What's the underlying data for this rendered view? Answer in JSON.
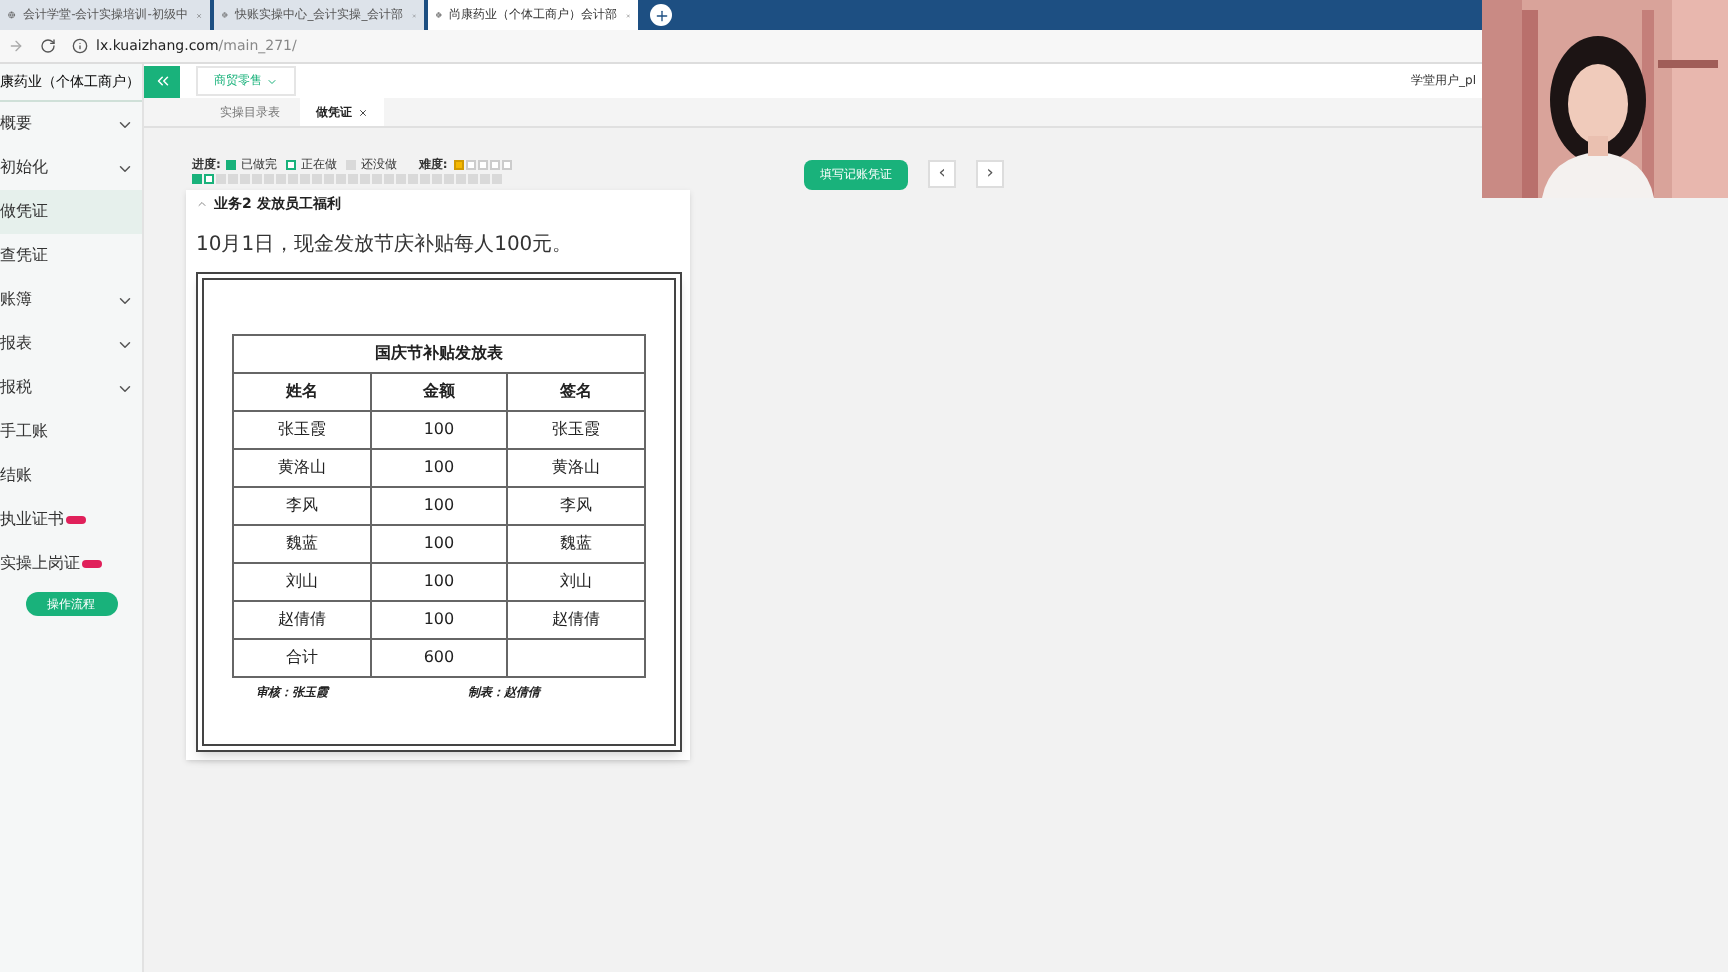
{
  "browser": {
    "tabs": [
      {
        "title": "会计学堂-会计实操培训-初级中",
        "selected": false
      },
      {
        "title": "快账实操中心_会计实操_会计部",
        "selected": false
      },
      {
        "title": "尚康药业（个体工商户）会计部",
        "selected": true
      }
    ],
    "address": {
      "host": "lx.kuaizhang.com",
      "path": "/main_271/"
    }
  },
  "sidebar": {
    "company": "康药业（个体工商户）",
    "items": [
      {
        "label": "概要",
        "expandable": true,
        "selected": false,
        "new": false
      },
      {
        "label": "初始化",
        "expandable": true,
        "selected": false,
        "new": false
      },
      {
        "label": "做凭证",
        "expandable": false,
        "selected": true,
        "new": false
      },
      {
        "label": "查凭证",
        "expandable": false,
        "selected": false,
        "new": false
      },
      {
        "label": "账簿",
        "expandable": true,
        "selected": false,
        "new": false
      },
      {
        "label": "报表",
        "expandable": true,
        "selected": false,
        "new": false
      },
      {
        "label": "报税",
        "expandable": true,
        "selected": false,
        "new": false
      },
      {
        "label": "手工账",
        "expandable": false,
        "selected": false,
        "new": false
      },
      {
        "label": "结账",
        "expandable": false,
        "selected": false,
        "new": false
      },
      {
        "label": "执业证书",
        "expandable": false,
        "selected": false,
        "new": true
      },
      {
        "label": "实操上岗证",
        "expandable": false,
        "selected": false,
        "new": true
      }
    ],
    "flow_button": "操作流程"
  },
  "header": {
    "industry": "商贸零售",
    "user": "学堂用户_pl"
  },
  "tabs": [
    {
      "label": "实操目录表",
      "selected": false,
      "closable": false
    },
    {
      "label": "做凭证",
      "selected": true,
      "closable": true
    }
  ],
  "progress": {
    "label": "进度:",
    "legend": [
      {
        "kind": "done",
        "label": "已做完"
      },
      {
        "kind": "current",
        "label": "正在做"
      },
      {
        "kind": "todo",
        "label": "还没做"
      }
    ],
    "difficulty_label": "难度:",
    "stars": 1,
    "steps": [
      {
        "kind": "done"
      },
      {
        "kind": "current"
      },
      {
        "kind": "todo"
      },
      {
        "kind": "todo"
      },
      {
        "kind": "todo"
      },
      {
        "kind": "todo"
      },
      {
        "kind": "todo"
      },
      {
        "kind": "todo"
      },
      {
        "kind": "todo"
      },
      {
        "kind": "todo"
      },
      {
        "kind": "todo"
      },
      {
        "kind": "todo"
      },
      {
        "kind": "todo"
      },
      {
        "kind": "todo"
      },
      {
        "kind": "todo"
      },
      {
        "kind": "todo"
      },
      {
        "kind": "todo"
      },
      {
        "kind": "todo"
      },
      {
        "kind": "todo"
      },
      {
        "kind": "todo"
      },
      {
        "kind": "todo"
      },
      {
        "kind": "todo"
      },
      {
        "kind": "todo"
      },
      {
        "kind": "todo"
      },
      {
        "kind": "todo"
      },
      {
        "kind": "todo"
      }
    ]
  },
  "fill_button": "填写记账凭证",
  "nav_prev": "‹",
  "nav_next": "›",
  "task": {
    "title": "业务2 发放员工福利",
    "description": "10月1日，现金发放节庆补贴每人100元。",
    "document": {
      "title": "国庆节补贴发放表",
      "columns": [
        "姓名",
        "金额",
        "签名"
      ],
      "rows": [
        [
          "张玉霞",
          "100",
          "张玉霞"
        ],
        [
          "黄洛山",
          "100",
          "黄洛山"
        ],
        [
          "李风",
          "100",
          "李风"
        ],
        [
          "魏蓝",
          "100",
          "魏蓝"
        ],
        [
          "刘山",
          "100",
          "刘山"
        ],
        [
          "赵倩倩",
          "100",
          "赵倩倩"
        ],
        [
          "合计",
          "600",
          ""
        ]
      ],
      "signatures": [
        "审核：张玉霞",
        "制表：赵倩倩"
      ]
    }
  }
}
